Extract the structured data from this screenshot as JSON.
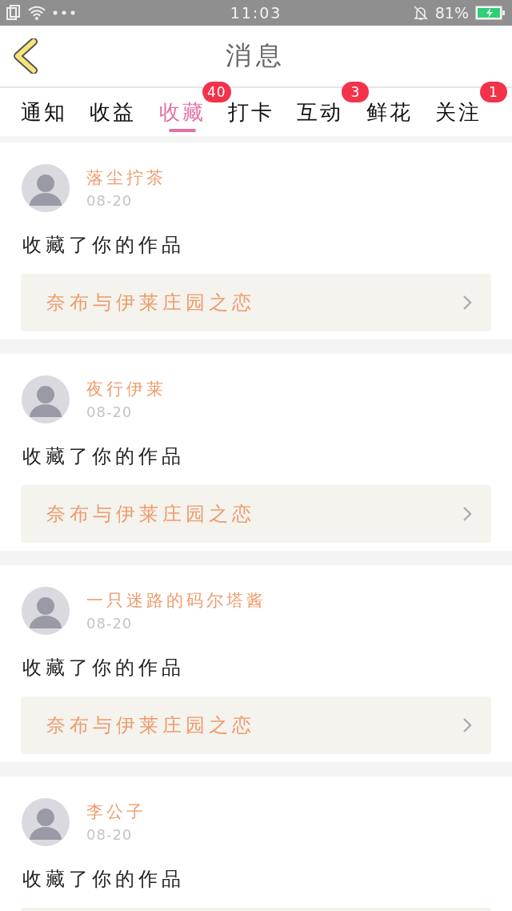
{
  "status_bar": {
    "time": "11:03",
    "battery_text": "81%"
  },
  "header": {
    "title": "消息"
  },
  "tabs": [
    {
      "label": "通知",
      "selected": false
    },
    {
      "label": "收益",
      "selected": false
    },
    {
      "label": "收藏",
      "selected": true,
      "badge": "40"
    },
    {
      "label": "打卡",
      "selected": false
    },
    {
      "label": "互动",
      "selected": false,
      "badge": "3"
    },
    {
      "label": "鲜花",
      "selected": false
    },
    {
      "label": "关注",
      "selected": false,
      "badge": "1"
    }
  ],
  "messages": [
    {
      "name": "落尘拧茶",
      "date": "08-20",
      "text": "收藏了你的作品",
      "work": "奈布与伊莱庄园之恋"
    },
    {
      "name": "夜行伊莱",
      "date": "08-20",
      "text": "收藏了你的作品",
      "work": "奈布与伊莱庄园之恋"
    },
    {
      "name": "一只迷路的码尔塔酱",
      "date": "08-20",
      "text": "收藏了你的作品",
      "work": "奈布与伊莱庄园之恋"
    },
    {
      "name": "李公子",
      "date": "08-20",
      "text": "收藏了你的作品"
    }
  ]
}
